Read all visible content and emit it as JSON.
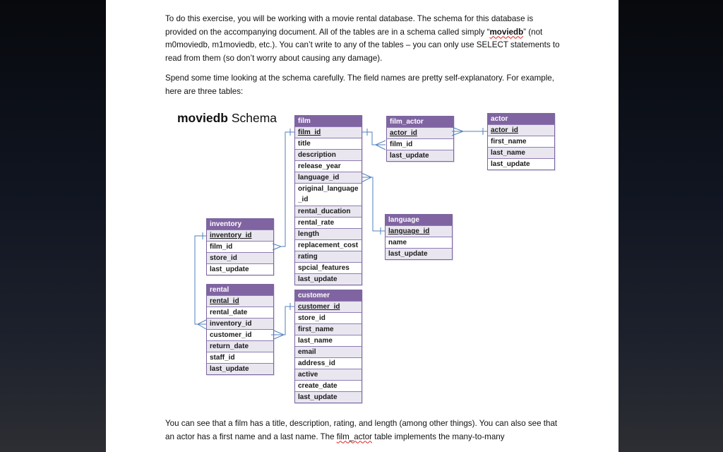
{
  "document": {
    "intro_paragraph": {
      "part1": "To do this exercise, you will be working with a movie rental database. The schema for this database is provided on the accompanying document. All of the tables are in a schema called simply “",
      "schema_name": "moviedb",
      "part2": "” (not m0moviedb, m1moviedb, etc.). You can’t write to any of the tables – you can only use SELECT statements to read from them (so don’t worry about causing any damage)."
    },
    "second_paragraph": "Spend some time looking at the schema carefully. The field names are pretty self-explanatory. For example, here are three tables:",
    "schema_title_bold": "moviedb",
    "schema_title_rest": " Schema",
    "closing_paragraph": {
      "part1": "You can see that a film has a title, description, rating, and length (among other things). You can also see that an actor has a first name and a last name. The ",
      "link_word": "film_actor",
      "part2": " table implements the many-to-many"
    }
  },
  "tables": {
    "film": {
      "name": "film",
      "fields": [
        "film_id",
        "title",
        "description",
        "release_year",
        "language_id",
        "original_language _id",
        "rental_ducation",
        "rental_rate",
        "length",
        "replacement_cost",
        "rating",
        "spcial_features",
        "last_update"
      ]
    },
    "film_actor": {
      "name": "film_actor",
      "fields": [
        "actor_id",
        "film_id",
        "last_update"
      ]
    },
    "actor": {
      "name": "actor",
      "fields": [
        "actor_id",
        "first_name",
        "last_name",
        "last_update"
      ]
    },
    "language": {
      "name": "language",
      "fields": [
        "language_id",
        "name",
        "last_update"
      ]
    },
    "inventory": {
      "name": "inventory",
      "fields": [
        "inventory_id",
        "film_id",
        "store_id",
        "last_update"
      ]
    },
    "rental": {
      "name": "rental",
      "fields": [
        "rental_id",
        "rental_date",
        "inventory_id",
        "customer_id",
        "return_date",
        "staff_id",
        "last_update"
      ]
    },
    "customer": {
      "name": "customer",
      "fields": [
        "customer_id",
        "store_id",
        "first_name",
        "last_name",
        "email",
        "address_id",
        "active",
        "create_date",
        "last_update"
      ]
    }
  },
  "colors": {
    "table_header": "#8064a2",
    "row_alt": "#e9e6f0",
    "connector": "#4f81bd"
  }
}
